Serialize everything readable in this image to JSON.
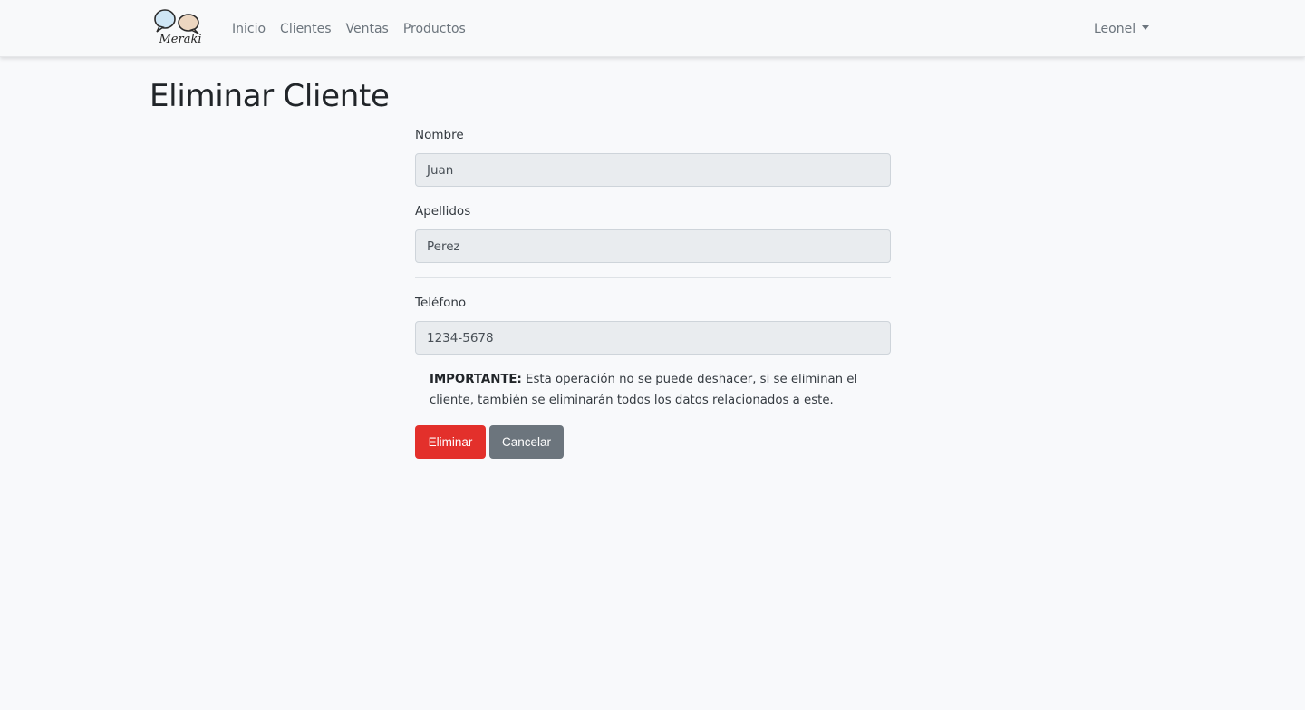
{
  "navbar": {
    "brand_text": "Meraki",
    "links": [
      "Inicio",
      "Clientes",
      "Ventas",
      "Productos"
    ],
    "user_name": "Leonel"
  },
  "page": {
    "title": "Eliminar Cliente"
  },
  "form": {
    "nombre_label": "Nombre",
    "nombre_value": "Juan",
    "apellidos_label": "Apellidos",
    "apellidos_value": "Perez",
    "telefono_label": "Teléfono",
    "telefono_value": "1234-5678",
    "notice_strong": "IMPORTANTE:",
    "notice_text": " Esta operación no se puede deshacer, si se eliminan el cliente, también se eliminarán todos los datos relacionados a este.",
    "delete_label": "Eliminar",
    "cancel_label": "Cancelar"
  },
  "colors": {
    "danger": "#e3302b",
    "secondary": "#6c757d",
    "input_bg": "#e9ecef"
  },
  "icons": {
    "brand_logo": "speech-bubbles-logo",
    "user_menu": "caret-down-icon"
  }
}
